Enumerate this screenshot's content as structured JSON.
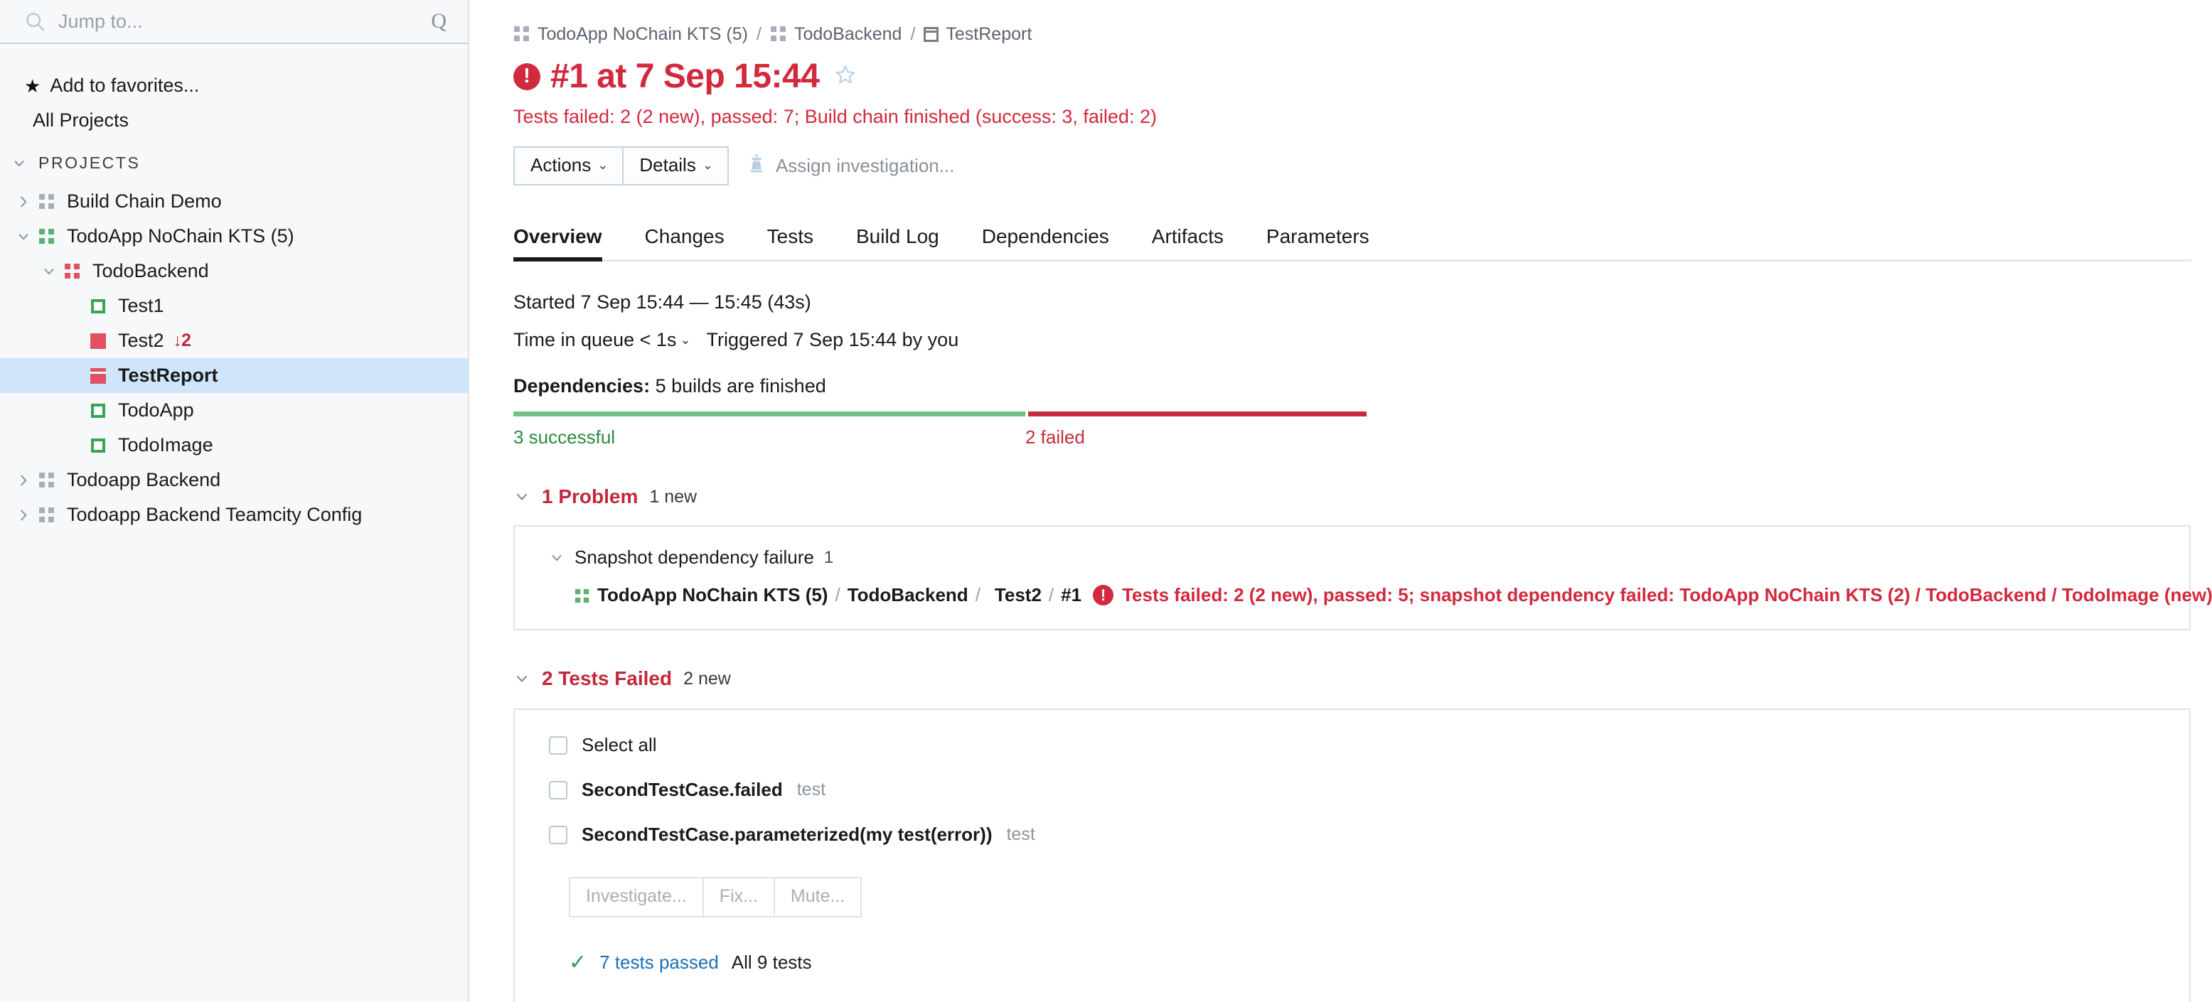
{
  "sidebar": {
    "search": {
      "placeholder": "Jump to...",
      "value": "",
      "q_glyph": "Q"
    },
    "favorites_label": "Add to favorites...",
    "all_projects_label": "All Projects",
    "section_label": "PROJECTS",
    "tree": [
      {
        "label": "Build Chain Demo",
        "icon": "project-grid-gray-icon",
        "chevron": "right",
        "indent": 1,
        "selected": false,
        "badge": ""
      },
      {
        "label": "TodoApp NoChain KTS (5)",
        "icon": "project-grid-green-icon",
        "chevron": "down",
        "indent": 1,
        "selected": false,
        "badge": ""
      },
      {
        "label": "TodoBackend",
        "icon": "project-grid-red-icon",
        "chevron": "down",
        "indent": 2,
        "selected": false,
        "badge": ""
      },
      {
        "label": "Test1",
        "icon": "build-success-square-icon",
        "chevron": "none",
        "indent": 3,
        "selected": false,
        "badge": ""
      },
      {
        "label": "Test2",
        "icon": "build-failed-square-icon",
        "chevron": "none",
        "indent": 3,
        "selected": false,
        "badge": "↓2"
      },
      {
        "label": "TestReport",
        "icon": "build-report-square-icon",
        "chevron": "none",
        "indent": 3,
        "selected": true,
        "badge": ""
      },
      {
        "label": "TodoApp",
        "icon": "build-success-square-icon",
        "chevron": "none",
        "indent": 3,
        "selected": false,
        "badge": ""
      },
      {
        "label": "TodoImage",
        "icon": "build-success-square-icon",
        "chevron": "none",
        "indent": 3,
        "selected": false,
        "badge": ""
      },
      {
        "label": "Todoapp Backend",
        "icon": "project-grid-gray-icon",
        "chevron": "right",
        "indent": 1,
        "selected": false,
        "badge": ""
      },
      {
        "label": "Todoapp Backend Teamcity Config",
        "icon": "project-grid-gray-icon",
        "chevron": "right",
        "indent": 1,
        "selected": false,
        "badge": ""
      }
    ]
  },
  "breadcrumb": {
    "project": "TodoApp NoChain KTS (5)",
    "subproject": "TodoBackend",
    "build_config": "TestReport",
    "separator": "/"
  },
  "header": {
    "title": "#1 at 7 Sep 15:44",
    "status_text": "Tests failed: 2 (2 new), passed: 7; Build chain finished (success: 3, failed: 2)",
    "error_glyph": "!",
    "star_title": "add to favorites"
  },
  "toolbar": {
    "actions_label": "Actions",
    "details_label": "Details",
    "caret_glyph": "⌄",
    "assign_label": "Assign investigation..."
  },
  "tabs": [
    {
      "label": "Overview",
      "active": true
    },
    {
      "label": "Changes",
      "active": false
    },
    {
      "label": "Tests",
      "active": false
    },
    {
      "label": "Build Log",
      "active": false
    },
    {
      "label": "Dependencies",
      "active": false
    },
    {
      "label": "Artifacts",
      "active": false
    },
    {
      "label": "Parameters",
      "active": false
    }
  ],
  "overview": {
    "started_line": "Started 7 Sep 15:44 — 15:45 (43s)",
    "queue_label": "Time in queue < 1s",
    "triggered_label": "Triggered 7 Sep 15:44 by you",
    "dependencies_label": "Dependencies:",
    "dependencies_value": "5 builds are finished",
    "bar": {
      "successful_label": "3 successful",
      "failed_label": "2 failed",
      "successful_count": 3,
      "failed_count": 2,
      "success_color": "#72c286",
      "failed_color": "#c72c3f"
    }
  },
  "problems": {
    "heading": "1 Problem",
    "heading_sub": "1 new",
    "group_label": "Snapshot dependency failure",
    "group_count": "1",
    "entry": {
      "project": "TodoApp NoChain KTS (5)",
      "subproject": "TodoBackend",
      "build": "Test2",
      "build_number": "#1",
      "message": "Tests failed: 2 (2 new), passed: 5; snapshot dependency failed: TodoApp NoChain KTS (2) / TodoBackend / TodoImage (new)",
      "separator": "/"
    }
  },
  "tests_failed": {
    "heading": "2 Tests Failed",
    "heading_sub": "2 new",
    "select_all_label": "Select all",
    "rows": [
      {
        "name": "SecondTestCase.failed",
        "kind": "test",
        "checked": false
      },
      {
        "name": "SecondTestCase.parameterized(my test(error))",
        "kind": "test",
        "checked": false
      }
    ],
    "actions": [
      {
        "label": "Investigate...",
        "disabled": true
      },
      {
        "label": "Fix...",
        "disabled": true
      },
      {
        "label": "Mute...",
        "disabled": true
      }
    ],
    "passed_label": "7 tests passed",
    "all_tests_label": "All 9 tests",
    "check_glyph": "✓"
  }
}
